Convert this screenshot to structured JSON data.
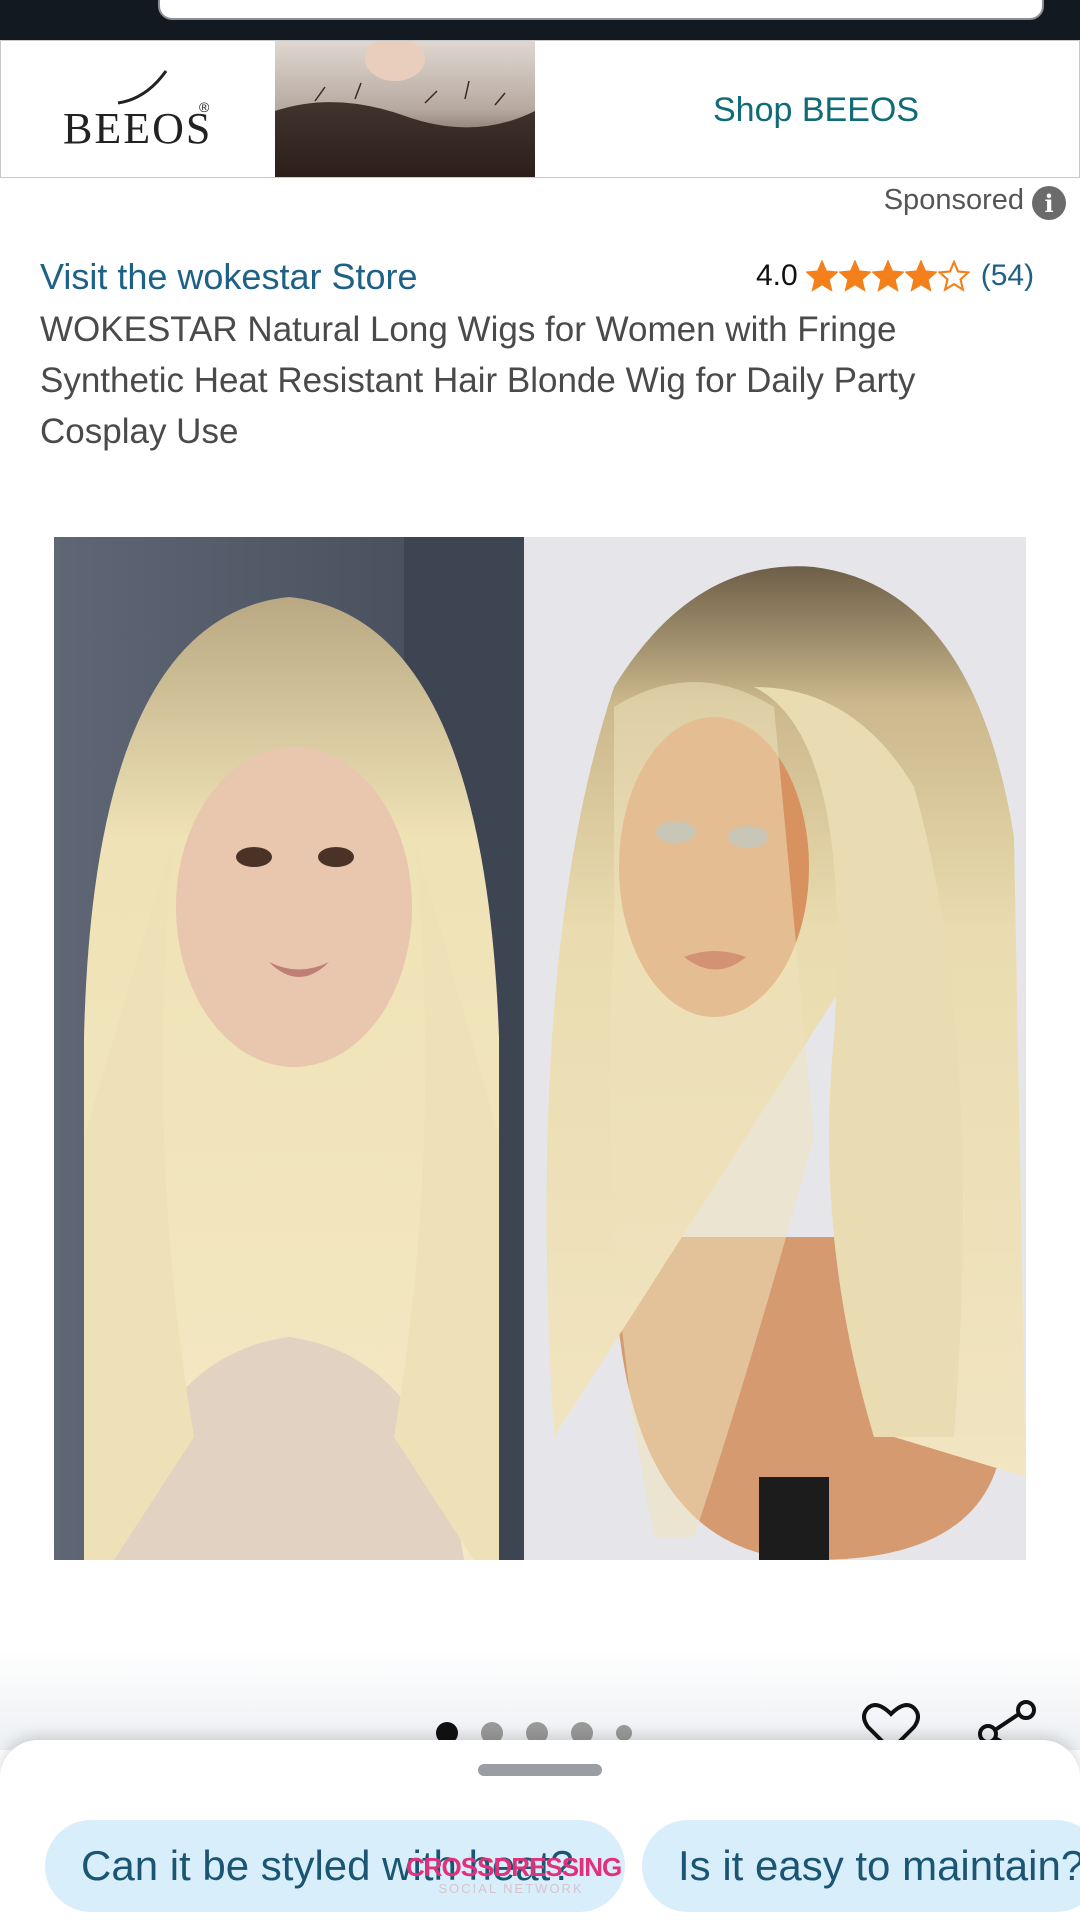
{
  "ad": {
    "brand": "BEEOS",
    "registered": "®",
    "cta": "Shop BEEOS"
  },
  "sponsored_label": "Sponsored",
  "product": {
    "store_link": "Visit the wokestar Store",
    "rating_value": "4.0",
    "rating_stars": 4,
    "rating_max": 5,
    "rating_count": "(54)",
    "title": "WOKESTAR Natural Long Wigs for Women with Fringe Synthetic Heat Resistant Hair Blonde Wig for Daily Party Cosplay Use"
  },
  "gallery": {
    "image_count": 5,
    "active_index": 0
  },
  "questions": [
    {
      "label": "Can it be styled with heat?"
    },
    {
      "label": "Is it easy to maintain?"
    }
  ],
  "watermark": {
    "main": "CROSSDRESSING",
    "sub": "SOCIAL NETWORK"
  },
  "icons": {
    "info": "info-icon",
    "star": "star-icon",
    "heart": "heart-icon",
    "share": "share-icon"
  },
  "colors": {
    "link": "#1e6187",
    "star": "#f3801b",
    "chip_bg": "#d9eefb",
    "top_bar": "#131921",
    "ad_cta": "#0f6b75"
  }
}
